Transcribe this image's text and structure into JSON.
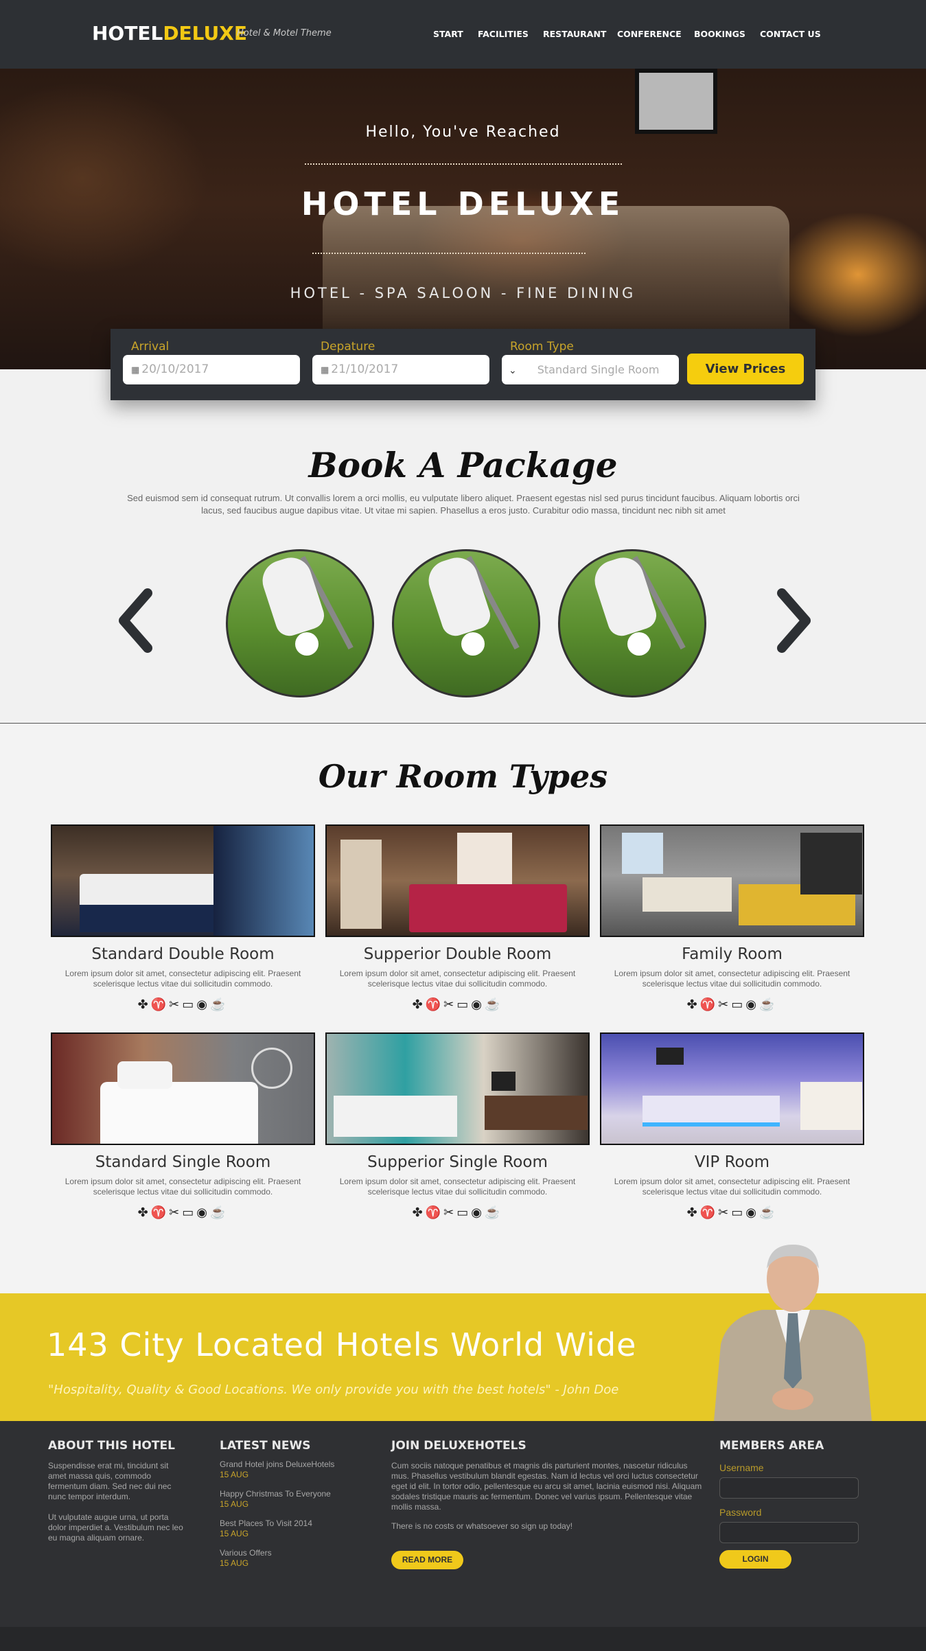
{
  "header": {
    "logo_part1": "HOTEL",
    "logo_part2": "DELUXE",
    "tagline": "Hotel & Motel Theme",
    "nav": [
      "START",
      "FACILITIES",
      "RESTAURANT",
      "CONFERENCE",
      "BOOKINGS",
      "CONTACT US"
    ]
  },
  "hero": {
    "hello": "Hello, You've Reached",
    "title": "HOTEL DELUXE",
    "subtitle": "HOTEL - SPA SALOON - FINE DINING"
  },
  "booking": {
    "arrival_label": "Arrival",
    "arrival_value": "20/10/2017",
    "departure_label": "Depature",
    "departure_value": "21/10/2017",
    "room_type_label": "Room Type",
    "room_type_value": "Standard Single Room",
    "button": "View Prices"
  },
  "package": {
    "title": "Book A Package",
    "text": "Sed euismod sem id consequat rutrum. Ut convallis lorem a orci mollis, eu vulputate libero aliquet. Praesent egestas nisl sed purus tincidunt faucibus. Aliquam lobortis orci lacus, sed faucibus augue dapibus vitae. Ut vitae mi sapien. Phasellus a eros justo. Curabitur odio massa, tincidunt nec nibh sit amet"
  },
  "rooms": {
    "title": "Our Room Types",
    "items": [
      {
        "name": "Standard Double Room",
        "desc": "Lorem ipsum dolor sit amet, consectetur adipiscing elit. Praesent scelerisque lectus vitae dui sollicitudin commodo."
      },
      {
        "name": "Supperior Double Room",
        "desc": "Lorem ipsum dolor sit amet, consectetur adipiscing elit. Praesent scelerisque lectus vitae dui sollicitudin commodo."
      },
      {
        "name": "Family Room",
        "desc": "Lorem ipsum dolor sit amet, consectetur adipiscing elit. Praesent scelerisque lectus vitae dui sollicitudin commodo."
      },
      {
        "name": "Standard Single Room",
        "desc": "Lorem ipsum dolor sit amet, consectetur adipiscing elit. Praesent scelerisque lectus vitae dui sollicitudin commodo."
      },
      {
        "name": "Supperior Single Room",
        "desc": "Lorem ipsum dolor sit amet, consectetur adipiscing elit. Praesent scelerisque lectus vitae dui sollicitudin commodo."
      },
      {
        "name": "VIP Room",
        "desc": "Lorem ipsum dolor sit amet, consectetur adipiscing elit. Praesent scelerisque lectus vitae dui sollicitudin commodo."
      }
    ],
    "amenity_icons": [
      "fan-icon",
      "hairdryer-icon",
      "ironing-icon",
      "tv-icon",
      "wifi-icon",
      "coffee-icon"
    ]
  },
  "banner": {
    "title": "143 City Located Hotels World Wide",
    "quote": "\"Hospitality, Quality & Good Locations. We only provide you with the best hotels\" - John Doe"
  },
  "footer": {
    "about_title": "ABOUT THIS HOTEL",
    "about_p1": "Suspendisse erat mi, tincidunt sit amet massa quis, commodo fermentum diam. Sed nec dui nec nunc tempor interdum.",
    "about_p2": "Ut vulputate augue urna, ut porta dolor imperdiet a. Vestibulum nec leo eu magna aliquam ornare.",
    "news_title": "LATEST NEWS",
    "news": [
      {
        "title": "Grand Hotel joins DeluxeHotels",
        "date": "15 AUG"
      },
      {
        "title": "Happy Christmas To Everyone",
        "date": "15 AUG"
      },
      {
        "title": "Best Places To Visit 2014",
        "date": "15 AUG"
      },
      {
        "title": "Various Offers",
        "date": "15 AUG"
      }
    ],
    "join_title": "JOIN DELUXEHOTELS",
    "join_text": "Cum sociis natoque penatibus et magnis dis parturient montes, nascetur ridiculus mus. Phasellus vestibulum blandit egestas. Nam id lectus vel orci luctus consectetur eget id elit. In tortor odio, pellentesque eu arcu sit amet, lacinia euismod nisi. Aliquam sodales tristique mauris ac fermentum. Donec vel varius ipsum. Pellentesque vitae mollis massa.",
    "join_note": "There is no costs or whatsoever so sign up today!",
    "read_more": "READ MORE",
    "members_title": "MEMBERS AREA",
    "username_label": "Username",
    "password_label": "Password",
    "login": "LOGIN"
  },
  "colors": {
    "accent": "#f3c914",
    "dark": "#2d3034",
    "banner": "#e6c826"
  }
}
